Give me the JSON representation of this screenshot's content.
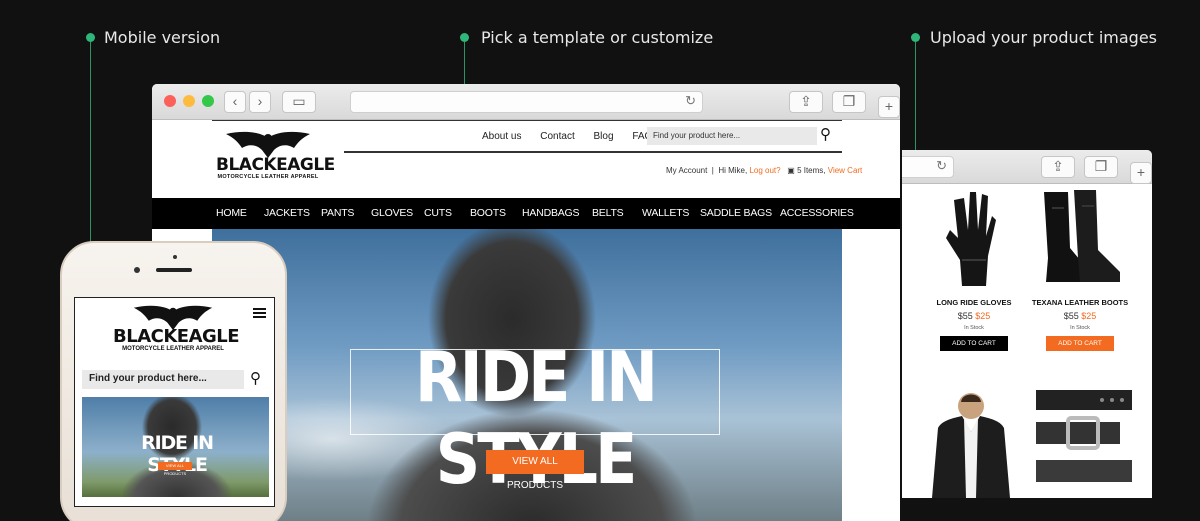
{
  "callouts": {
    "mobile": "Mobile version",
    "template": "Pick a template or customize",
    "upload": "Upload your product images"
  },
  "site": {
    "brand": "BLACKEAGLE",
    "tagline": "MOTORCYCLE LEATHER APPAREL",
    "top_links": [
      "About us",
      "Contact",
      "Blog",
      "FAQ"
    ],
    "search_placeholder": "Find your product here...",
    "account": {
      "my_account": "My Account",
      "greeting": "Hi Mike,",
      "logout": "Log out?",
      "cart_count": "5 Items,",
      "view_cart": "View Cart"
    },
    "nav": [
      "HOME",
      "JACKETS",
      "PANTS",
      "GLOVES",
      "CUTS",
      "BOOTS",
      "HANDBAGS",
      "BELTS",
      "WALLETS",
      "SADDLE BAGS",
      "ACCESSORIES"
    ],
    "hero": {
      "title": "RIDE IN STYLE",
      "button": "VIEW ALL PRODUCTS"
    }
  },
  "products": [
    {
      "name": "LONG RIDE GLOVES",
      "old_price": "$55",
      "price": "$25",
      "stock": "In Stock",
      "button": "ADD TO CART",
      "button_color": "#000000"
    },
    {
      "name": "TEXANA LEATHER BOOTS",
      "old_price": "$55",
      "price": "$25",
      "stock": "In Stock",
      "button": "ADD TO CART",
      "button_color": "#f26b21"
    }
  ],
  "mobile": {
    "brand": "BLACKEAGLE",
    "tagline": "MOTORCYCLE LEATHER APPAREL",
    "search_placeholder": "Find your product here...",
    "hero_title": "RIDE IN STYLE",
    "hero_button": "VIEW ALL PRODUCTS"
  },
  "colors": {
    "accent": "#f26b21",
    "callout_dot": "#2fb67a",
    "background": "#111111"
  }
}
